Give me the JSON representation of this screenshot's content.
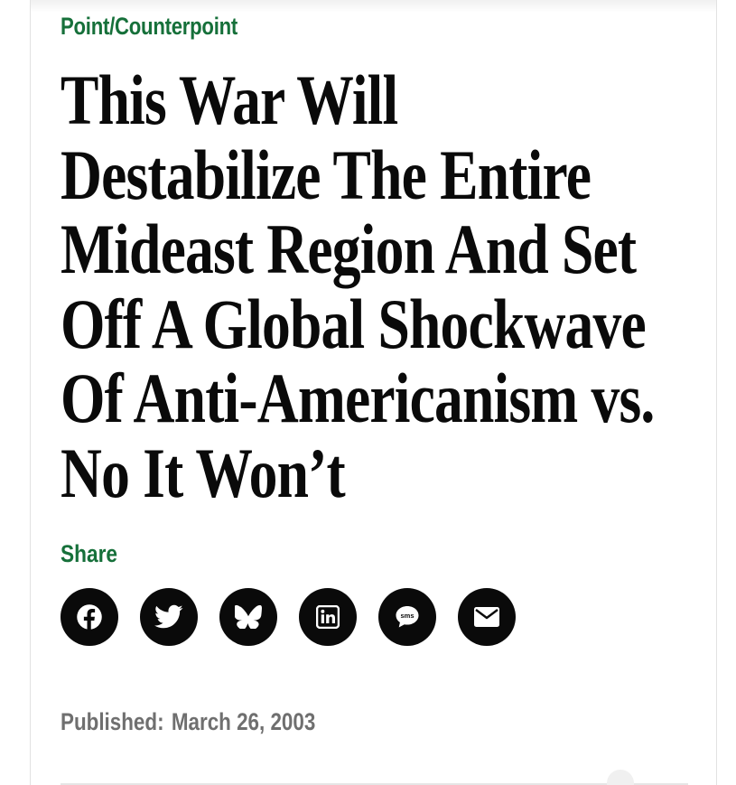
{
  "article": {
    "kicker": "Point/Counterpoint",
    "headline": "This War Will Destabilize The Entire Mideast Region And Set Off A Global Shockwave Of Anti-Americanism vs. No It Won’t",
    "share_label": "Share",
    "published_label": "Published:",
    "published_date": "March 26, 2003"
  },
  "share_buttons": [
    {
      "icon": "facebook-icon"
    },
    {
      "icon": "twitter-icon"
    },
    {
      "icon": "bluesky-icon"
    },
    {
      "icon": "linkedin-icon"
    },
    {
      "icon": "sms-icon",
      "text": "sms"
    },
    {
      "icon": "email-icon"
    }
  ],
  "colors": {
    "accent_green": "#16703a",
    "headline_black": "#0a0a0a",
    "muted_gray": "#6f6f6f",
    "button_black": "#0a0a0a"
  }
}
